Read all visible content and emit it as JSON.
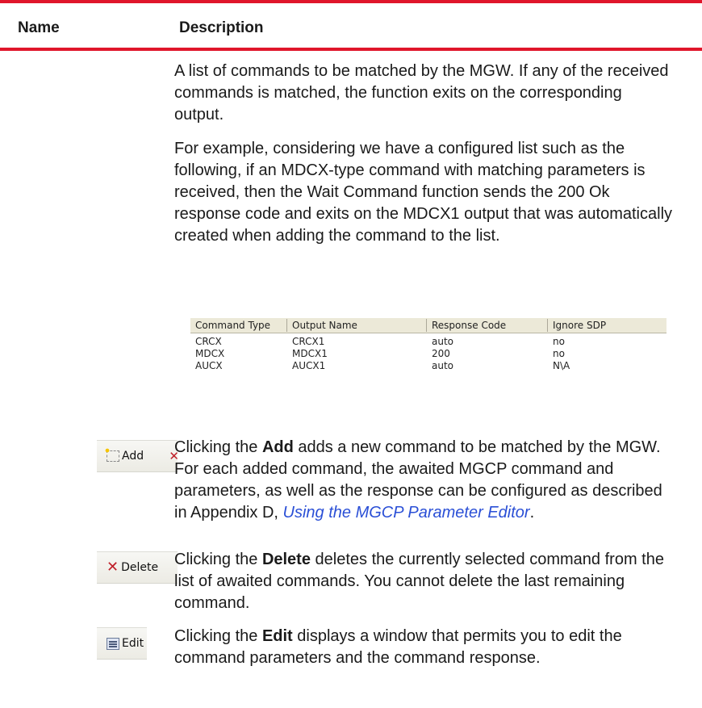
{
  "header": {
    "name": "Name",
    "description": "Description"
  },
  "intro": {
    "p1": "A list of commands to be matched by the MGW. If any of the received commands is matched, the function exits on the corresponding output.",
    "p2": "For example, considering we have a configured list such as the following, if an MDCX-type command with matching parameters is received, then the Wait Command function sends the 200 Ok response code and exits on the MDCX1 output that was automatically created when adding the command to the list."
  },
  "command_table": {
    "headers": [
      "Command Type",
      "Output Name",
      "Response Code",
      "Ignore SDP"
    ],
    "rows": [
      [
        "CRCX",
        "CRCX1",
        "auto",
        "no"
      ],
      [
        "MDCX",
        "MDCX1",
        "200",
        "no"
      ],
      [
        "AUCX",
        "AUCX1",
        "auto",
        "N\\A"
      ]
    ]
  },
  "add": {
    "button_label": "Add",
    "text_pre": "Clicking the ",
    "bold": "Add",
    "text_post": " adds a new command to be matched by the MGW. For each added command, the awaited MGCP command and parameters, as well as the response can be configured as described in Appendix D, ",
    "link": "Using the MGCP Parameter Editor",
    "text_end": "."
  },
  "delete": {
    "button_label": "Delete",
    "text_pre": "Clicking the ",
    "bold": "Delete",
    "text_post": " deletes the currently selected command from the list of awaited commands. You cannot delete the last remaining command."
  },
  "edit": {
    "button_label": "Edit",
    "text_pre": "Clicking the ",
    "bold": "Edit",
    "text_post": " displays a window that permits you to edit the command parameters and the command response."
  },
  "colors": {
    "rule": "#e0162b",
    "link": "#2a4fd6"
  }
}
